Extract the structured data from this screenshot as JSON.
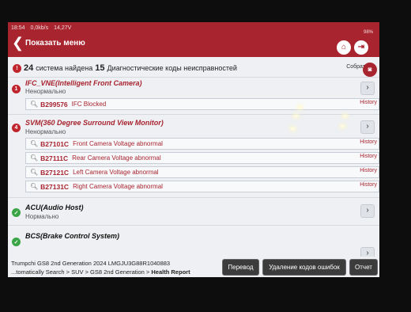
{
  "status_bar": {
    "time": "18:54",
    "net": "0,0kb/s",
    "voltage": "14,27V",
    "battery": "98%"
  },
  "header": {
    "back": "❮",
    "title": "Показать меню"
  },
  "summary": {
    "systems_count": "24",
    "systems_text": "система найдена",
    "codes_count": "15",
    "codes_text": "Диагностические коды неисправностей",
    "collect_label": "Собрат"
  },
  "systems": [
    {
      "name": "IFC_VNE(Intelligent Front Camera)",
      "state": "Ненормально",
      "badge": "1",
      "dtcs": [
        {
          "code": "B299576",
          "desc": "IFC Blocked",
          "history": "History"
        }
      ]
    },
    {
      "name": "SVM(360 Degree Surround View Monitor)",
      "state": "Ненормально",
      "badge": "4",
      "dtcs": [
        {
          "code": "B27101C",
          "desc": "Front Camera Voltage abnormal",
          "history": "History"
        },
        {
          "code": "B27111C",
          "desc": "Rear Camera Voltage  abnormal",
          "history": "History"
        },
        {
          "code": "B27121C",
          "desc": "Left Camera Voltage abnormal",
          "history": "History"
        },
        {
          "code": "B27131C",
          "desc": "Right Camera Voltage abnormal",
          "history": "History"
        }
      ]
    },
    {
      "name": "ACU(Audio Host)",
      "state": "Нормально",
      "badge": "✓"
    },
    {
      "name": "BCS(Brake Control System)",
      "state": "",
      "badge": "✓"
    }
  ],
  "bottom_bar": {
    "vehicle": "Trumpchi  GS8 2nd Generation 2024  LMGJU3G88R1040883",
    "path": "...tomatically Search > SUV > GS8 2nd Generation > ",
    "path_current": "Health Report",
    "buttons": {
      "translate": "Перевод",
      "clear_codes": "Удаление кодов ошибок",
      "report": "Отчет"
    }
  },
  "colors": {
    "header": "#a8242f",
    "fault": "#c0242c",
    "ok": "#3aa545"
  }
}
